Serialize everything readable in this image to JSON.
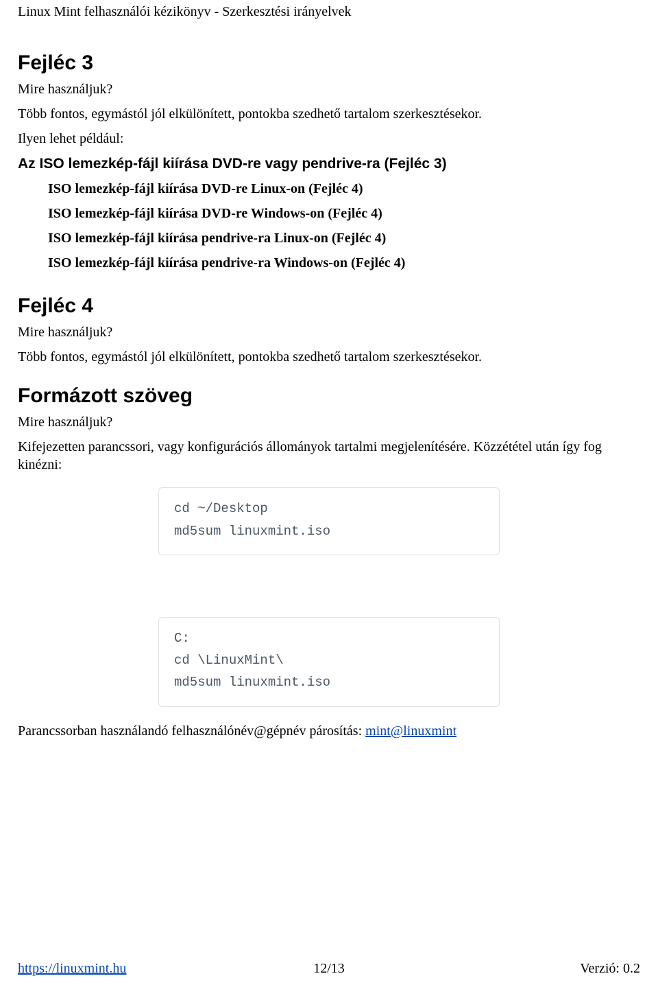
{
  "header": "Linux Mint felhasználói kézikönyv - Szerkesztési irányelvek",
  "section3": {
    "title": "Fejléc 3",
    "q": "Mire használjuk?",
    "desc": "Több fontos, egymástól jól elkülönített, pontokba szedhető tartalom szerkesztésekor.",
    "intro": "Ilyen lehet például:",
    "example_heading": "Az ISO lemezkép-fájl kiírása DVD-re vagy pendrive-ra (Fejléc 3)",
    "items": [
      "ISO lemezkép-fájl kiírása DVD-re Linux-on (Fejléc 4)",
      "ISO lemezkép-fájl kiírása DVD-re Windows-on (Fejléc 4)",
      "ISO lemezkép-fájl kiírása pendrive-ra Linux-on (Fejléc 4)",
      "ISO lemezkép-fájl kiírása pendrive-ra Windows-on (Fejléc 4)"
    ]
  },
  "section4": {
    "title": "Fejléc 4",
    "q": "Mire használjuk?",
    "desc": "Több fontos, egymástól jól elkülönített, pontokba szedhető tartalom szerkesztésekor."
  },
  "formatted": {
    "title": "Formázott szöveg",
    "q": "Mire használjuk?",
    "desc": "Kifejezetten parancssori, vagy konfigurációs állományok tartalmi megjelenítésére. Közzététel után így fog kinézni:"
  },
  "codeA": "cd ~/Desktop\nmd5sum linuxmint.iso",
  "codeB": "C:\ncd \\LinuxMint\\\nmd5sum linuxmint.iso",
  "cmdline": {
    "prefix": "Parancssorban használandó felhasználónév@gépnév párosítás: ",
    "link_text": "mint@linuxmint",
    "link_href": "mailto:mint@linuxmint"
  },
  "footer": {
    "url_text": "https://linuxmint.hu",
    "url_href": "https://linuxmint.hu",
    "page": "12/13",
    "version": "Verzió: 0.2"
  }
}
